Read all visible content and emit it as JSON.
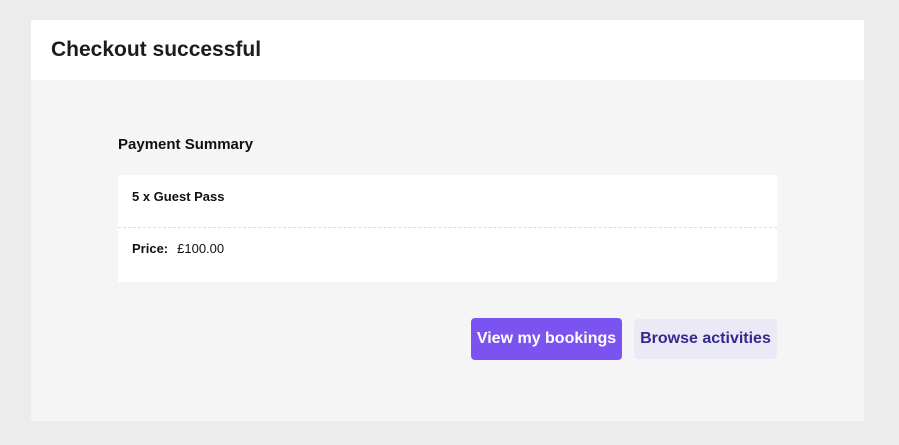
{
  "header": {
    "title": "Checkout successful"
  },
  "summary": {
    "heading": "Payment Summary",
    "item": "5 x Guest Pass",
    "price_label": "Price:",
    "price_value": "£100.00"
  },
  "actions": {
    "view_bookings_label": "View my bookings",
    "browse_activities_label": "Browse activities"
  },
  "colors": {
    "primary_button": "#7b53f0",
    "secondary_button_bg": "#ebe9f6",
    "secondary_button_text": "#332a8c"
  }
}
